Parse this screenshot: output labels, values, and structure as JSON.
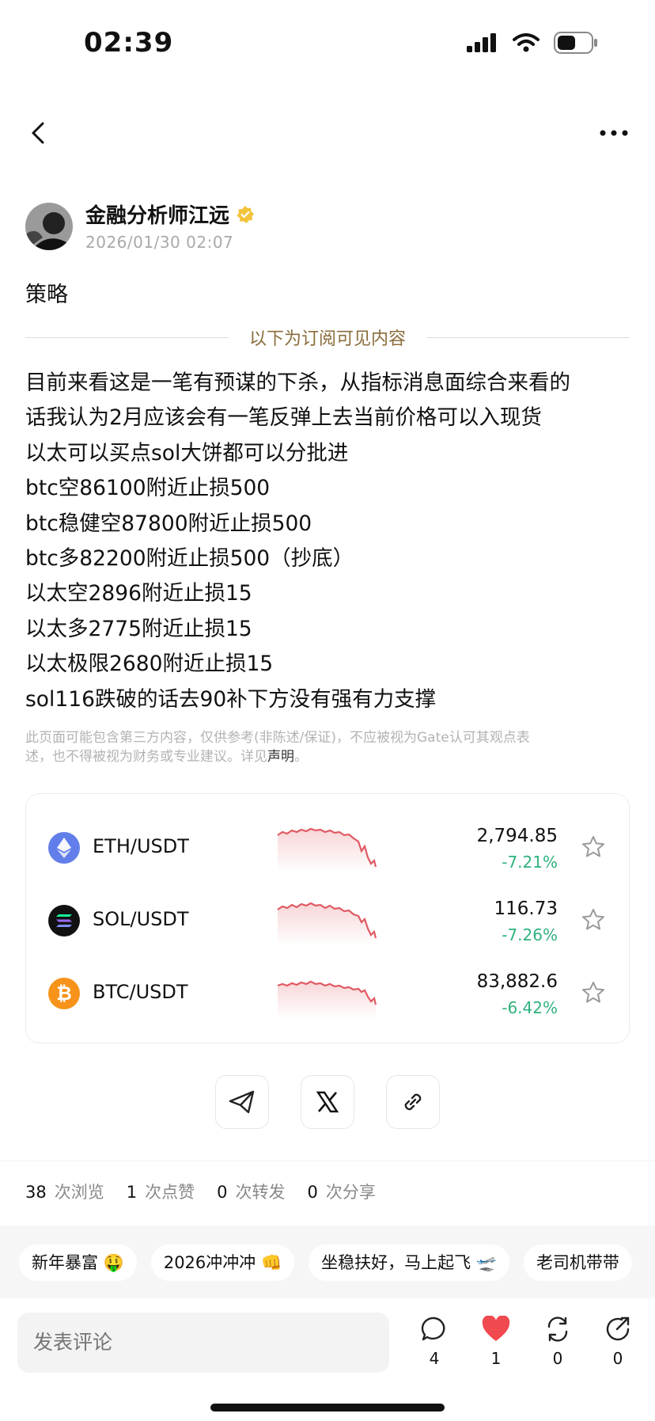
{
  "status_bar": {
    "time": "02:39"
  },
  "author": {
    "name": "金融分析师江远",
    "verified_icon": "verified-badge-icon",
    "time": "2026/01/30 02:07"
  },
  "post": {
    "title": "策略",
    "subscription_notice": "以下为订阅可见内容",
    "lines": [
      "目前来看这是一笔有预谋的下杀，从指标消息面综合来看的",
      "话我认为2月应该会有一笔反弹上去当前价格可以入现货",
      "以太可以买点sol大饼都可以分批进",
      "btc空86100附近止损500",
      "btc稳健空87800附近止损500",
      "btc多82200附近止损500（抄底）",
      "以太空2896附近止损15",
      "以太多2775附近止损15",
      "以太极限2680附近止损15",
      "sol116跌破的话去90补下方没有强有力支撑"
    ],
    "disclaimer_line1": "此页面可能包含第三方内容，仅供参考(非陈述/保证)，不应被视为Gate认可其观点表",
    "disclaimer_line2_pre": "述，也不得被视为财务或专业建议。详见",
    "disclaimer_link": "声明",
    "disclaimer_end": "。"
  },
  "markets": [
    {
      "pair": "ETH/USDT",
      "price": "2,794.85",
      "change": "-7.21%",
      "icon": "eth-icon",
      "color": "#627eea"
    },
    {
      "pair": "SOL/USDT",
      "price": "116.73",
      "change": "-7.26%",
      "icon": "sol-icon",
      "color": "#111111"
    },
    {
      "pair": "BTC/USDT",
      "price": "83,882.6",
      "change": "-6.42%",
      "icon": "btc-icon",
      "color": "#f7931a"
    }
  ],
  "stats": [
    {
      "value": "38",
      "unit": "次浏览"
    },
    {
      "value": "1",
      "unit": "次点赞"
    },
    {
      "value": "0",
      "unit": "次转发"
    },
    {
      "value": "0",
      "unit": "次分享"
    }
  ],
  "tags": [
    "新年暴富 🤑",
    "2026冲冲冲 👊",
    "坐稳扶好，马上起飞 🛫",
    "老司机带带"
  ],
  "comment": {
    "placeholder": "发表评论"
  },
  "actions": [
    {
      "icon": "comment-icon",
      "count": "4"
    },
    {
      "icon": "heart-icon",
      "count": "1"
    },
    {
      "icon": "repost-icon",
      "count": "0"
    },
    {
      "icon": "share-icon",
      "count": "0"
    }
  ],
  "colors": {
    "accent_gold": "#8a6d3b",
    "down_green": "#2fb27d",
    "like_red": "#f0494f",
    "spark_red": "#e05a63"
  }
}
